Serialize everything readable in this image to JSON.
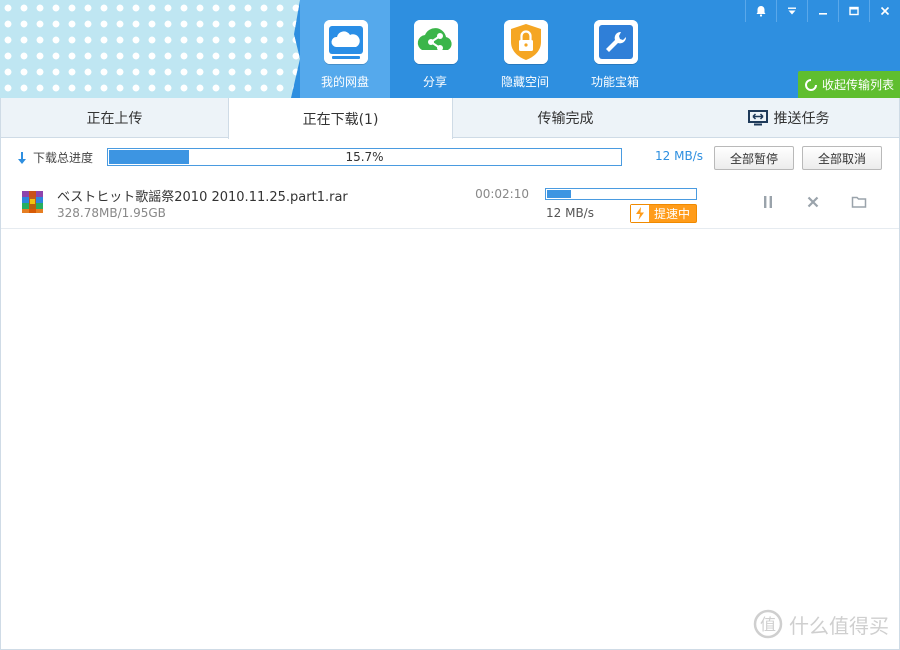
{
  "window": {
    "buttons": [
      {
        "icon": "bell-icon"
      },
      {
        "icon": "menu-dropdown-icon"
      },
      {
        "icon": "minimize-icon"
      },
      {
        "icon": "maximize-icon"
      },
      {
        "icon": "close-icon"
      }
    ]
  },
  "nav": {
    "items": [
      {
        "label": "我的网盘",
        "icon": "cloud-icon",
        "active": true,
        "color": "#2a8ee6"
      },
      {
        "label": "分享",
        "icon": "share-icon",
        "active": false,
        "color": "#3bb54a"
      },
      {
        "label": "隐藏空间",
        "icon": "lock-icon",
        "active": false,
        "color": "#f5a623"
      },
      {
        "label": "功能宝箱",
        "icon": "wrench-icon",
        "active": false,
        "color": "#2f7fd8"
      }
    ],
    "collapse_button": "收起传输列表",
    "collapse_icon": "refresh-icon"
  },
  "tabs": {
    "items": [
      {
        "label": "正在上传",
        "active": false
      },
      {
        "label": "正在下载(1)",
        "active": true
      },
      {
        "label": "传输完成",
        "active": false
      },
      {
        "label": "推送任务",
        "active": false,
        "icon": "monitor-icon"
      }
    ]
  },
  "total": {
    "label": "下载总进度",
    "icon": "download-arrow-icon",
    "progress_fraction": 0.157,
    "percent_text": "15.7%",
    "speed": "12 MB/s",
    "pause_all": "全部暂停",
    "cancel_all": "全部取消"
  },
  "downloads": [
    {
      "icon": "rar-archive-icon",
      "name": "ベストヒット歌謡祭2010 2010.11.25.part1.rar",
      "size": "328.78MB/1.95GB",
      "time_remaining": "00:02:10",
      "progress_fraction": 0.165,
      "speed": "12 MB/s",
      "boost_label": "提速中",
      "boost_icon": "lightning-icon",
      "actions": [
        "pause-icon",
        "cancel-icon",
        "folder-icon"
      ]
    }
  ],
  "watermark": {
    "text": "什么值得买",
    "icon": "smzdm-logo-icon"
  },
  "colors": {
    "header": "#2e8fe0",
    "accent": "#3d95e2",
    "boost": "#ff9c1a",
    "collapse_button": "#5fbe2f"
  }
}
